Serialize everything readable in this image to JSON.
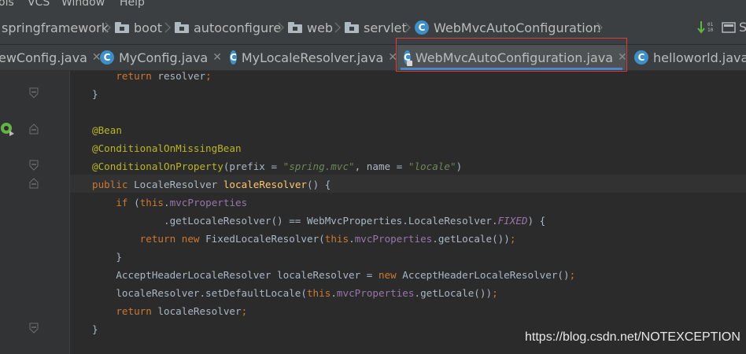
{
  "menu": {
    "items": [
      "ols",
      "VCS",
      "Window",
      "Help"
    ]
  },
  "breadcrumb": {
    "items": [
      "springframework",
      "boot",
      "autoconfigure",
      "web",
      "servlet",
      "WebMvcAutoConfiguration"
    ]
  },
  "toolbar": {
    "icon_label": "S"
  },
  "tabs": [
    {
      "label": "ewConfig.java"
    },
    {
      "label": "MyConfig.java"
    },
    {
      "label": "MyLocaleResolver.java"
    },
    {
      "label": "WebMvcAutoConfiguration.java"
    },
    {
      "label": "helloworld.java"
    }
  ],
  "code": {
    "lines": [
      "    return resolver;",
      "}",
      "",
      "@Bean",
      "@ConditionalOnMissingBean",
      "@ConditionalOnProperty(prefix = \"spring.mvc\", name = \"locale\")",
      "public LocaleResolver localeResolver() {",
      "    if (this.mvcProperties",
      "            .getLocaleResolver() == WebMvcProperties.LocaleResolver.FIXED) {",
      "        return new FixedLocaleResolver(this.mvcProperties.getLocale());",
      "    }",
      "    AcceptHeaderLocaleResolver localeResolver = new AcceptHeaderLocaleResolver();",
      "    localeResolver.setDefaultLocale(this.mvcProperties.getLocale());",
      "    return localeResolver;",
      "}"
    ]
  },
  "watermark": "https://blog.csdn.net/NOTEXCEPTION",
  "colors": {
    "keyword": "#cc7832",
    "annotation": "#bbb529",
    "string": "#6a8759",
    "field": "#9876aa",
    "method": "#ffc66d",
    "highlight_box": "#e03e3e",
    "tab_underline": "#4a88c7"
  }
}
